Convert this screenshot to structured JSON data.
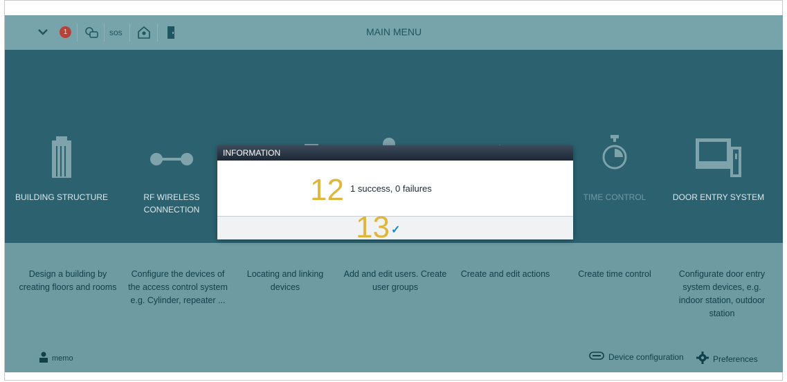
{
  "header": {
    "title": "MAIN MENU",
    "notification_count": "1",
    "sos_label": "SOS"
  },
  "tiles": [
    {
      "label": "BUILDING STRUCTURE",
      "icon": "building-icon"
    },
    {
      "label": "RF WIRELESS CONNECTION",
      "icon": "rf-connection-icon"
    },
    {
      "label": "",
      "icon": "linking-icon"
    },
    {
      "label": "",
      "icon": "user-icon"
    },
    {
      "label": "",
      "icon": "actions-icon"
    },
    {
      "label": "TIME CONTROL",
      "icon": "timer-icon"
    },
    {
      "label": "DOOR ENTRY SYSTEM",
      "icon": "door-entry-icon"
    }
  ],
  "descriptions": [
    "Design a building by creating floors and rooms",
    "Configure the devices of the access control system e.g. Cylinder, repeater ...",
    "Locating and linking devices",
    "Add and edit users. Create user groups",
    "Create and edit actions",
    "Create time control",
    "Configurate door entry system devices, e.g. indoor station, outdoor station"
  ],
  "footer": {
    "user_label": "memo",
    "device_config_label": "Device configuration",
    "preferences_label": "Preferences"
  },
  "dialog": {
    "title": "INFORMATION",
    "message": "1 success, 0 failures",
    "ok_symbol": "✓"
  },
  "callouts": {
    "message_number": "12",
    "ok_number": "13"
  },
  "colors": {
    "band": "#2c6270",
    "background": "#6e9aa2",
    "callout": "#e0b53a",
    "badge": "#b84239",
    "ok_check": "#1a88c0"
  }
}
